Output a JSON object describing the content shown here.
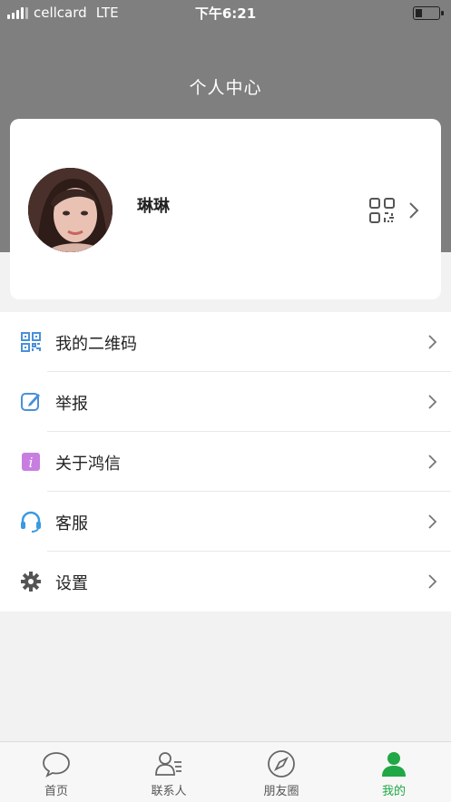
{
  "status_bar": {
    "carrier": "cellcard",
    "network": "LTE",
    "time": "下午6:21"
  },
  "header": {
    "title": "个人中心"
  },
  "profile": {
    "name": "琳琳"
  },
  "menu": {
    "items": [
      {
        "label": "我的二维码",
        "icon": "qrcode-icon"
      },
      {
        "label": "举报",
        "icon": "edit-icon"
      },
      {
        "label": "关于鸿信",
        "icon": "info-icon"
      },
      {
        "label": "客服",
        "icon": "headset-icon"
      },
      {
        "label": "设置",
        "icon": "gear-icon"
      }
    ]
  },
  "tabbar": {
    "tabs": [
      {
        "label": "首页",
        "icon": "chat-bubble-icon"
      },
      {
        "label": "联系人",
        "icon": "contacts-icon"
      },
      {
        "label": "朋友圈",
        "icon": "compass-icon"
      },
      {
        "label": "我的",
        "icon": "person-icon"
      }
    ],
    "active_index": 3
  },
  "colors": {
    "header_bg": "#7f7f7f",
    "accent_green": "#1fa845",
    "qr_icon": "#4a90d9",
    "info_icon": "#c77ee0",
    "headset_icon": "#3a9ae0"
  }
}
